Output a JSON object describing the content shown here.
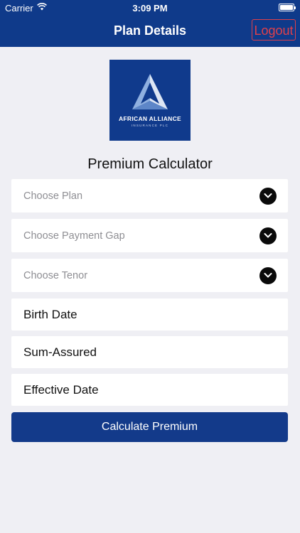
{
  "status_bar": {
    "carrier": "Carrier",
    "time": "3:09 PM"
  },
  "nav": {
    "title": "Plan Details",
    "logout_label": "Logout"
  },
  "logo": {
    "name": "AFRICAN ALLIANCE",
    "subtitle": "INSURANCE PLC"
  },
  "calculator": {
    "title": "Premium Calculator",
    "dropdowns": [
      {
        "placeholder": "Choose Plan",
        "icon": "chevron-down-icon"
      },
      {
        "placeholder": "Choose Payment Gap",
        "icon": "chevron-down-icon"
      },
      {
        "placeholder": "Choose Tenor",
        "icon": "chevron-down-icon"
      }
    ],
    "fields": [
      {
        "label": "Birth Date"
      },
      {
        "label": "Sum-Assured"
      },
      {
        "label": "Effective Date"
      }
    ],
    "button_label": "Calculate Premium"
  },
  "colors": {
    "primary": "#0f3a8a",
    "logout": "#e0404a",
    "background": "#efeff4"
  }
}
